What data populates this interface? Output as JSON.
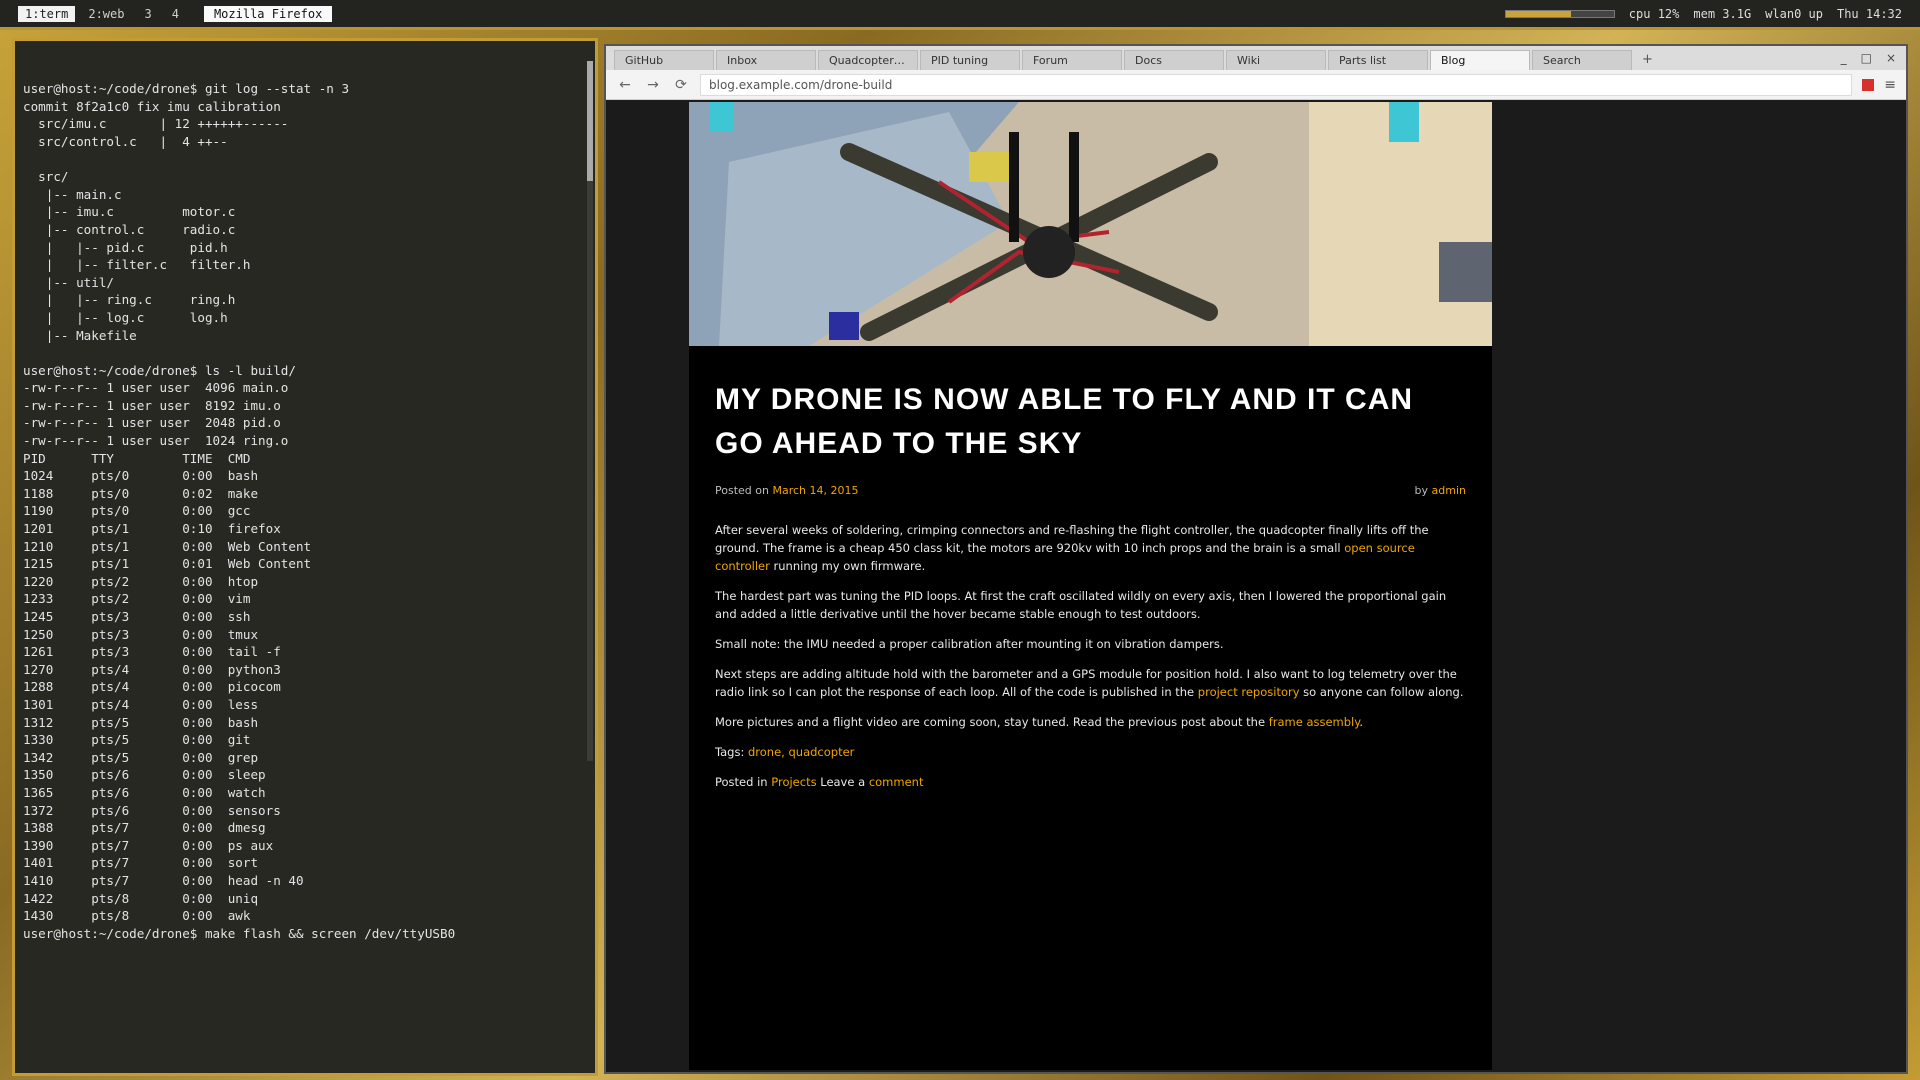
{
  "topbar": {
    "workspaces": [
      {
        "label": "1:term",
        "active": true
      },
      {
        "label": "2:web",
        "active": false
      },
      {
        "label": "3",
        "active": false
      },
      {
        "label": "4",
        "active": false
      }
    ],
    "window_title": "Mozilla Firefox",
    "volume_pct": 60,
    "status": [
      "cpu 12%",
      "mem 3.1G",
      "wlan0 up",
      "Thu 14:32"
    ]
  },
  "terminal": {
    "lines": [
      "user@host:~/code/drone$ git log --stat -n 3",
      "commit 8f2a1c0 fix imu calibration",
      "  src/imu.c       | 12 ++++++------",
      "  src/control.c   |  4 ++--",
      "",
      "  src/",
      "   |-- main.c",
      "   |-- imu.c         motor.c",
      "   |-- control.c     radio.c",
      "   |   |-- pid.c      pid.h",
      "   |   |-- filter.c   filter.h",
      "   |-- util/",
      "   |   |-- ring.c     ring.h",
      "   |   |-- log.c      log.h",
      "   |-- Makefile",
      "",
      "user@host:~/code/drone$ ls -l build/",
      "-rw-r--r-- 1 user user  4096 main.o",
      "-rw-r--r-- 1 user user  8192 imu.o",
      "-rw-r--r-- 1 user user  2048 pid.o",
      "-rw-r--r-- 1 user user  1024 ring.o",
      "PID      TTY         TIME  CMD",
      "1024     pts/0       0:00  bash",
      "1188     pts/0       0:02  make",
      "1190     pts/0       0:00  gcc",
      "1201     pts/1       0:10  firefox",
      "1210     pts/1       0:00  Web Content",
      "1215     pts/1       0:01  Web Content",
      "1220     pts/2       0:00  htop",
      "1233     pts/2       0:00  vim",
      "1245     pts/3       0:00  ssh",
      "1250     pts/3       0:00  tmux",
      "1261     pts/3       0:00  tail -f",
      "1270     pts/4       0:00  python3",
      "1288     pts/4       0:00  picocom",
      "1301     pts/4       0:00  less",
      "1312     pts/5       0:00  bash",
      "1330     pts/5       0:00  git",
      "1342     pts/5       0:00  grep",
      "1350     pts/6       0:00  sleep",
      "1365     pts/6       0:00  watch",
      "1372     pts/6       0:00  sensors",
      "1388     pts/7       0:00  dmesg",
      "1390     pts/7       0:00  ps aux",
      "1401     pts/7       0:00  sort",
      "1410     pts/7       0:00  head -n 40",
      "1422     pts/8       0:00  uniq",
      "1430     pts/8       0:00  awk",
      "user@host:~/code/drone$ make flash && screen /dev/ttyUSB0"
    ]
  },
  "browser": {
    "tabs": [
      {
        "label": "GitHub",
        "active": false
      },
      {
        "label": "Inbox",
        "active": false
      },
      {
        "label": "Quadcopter build",
        "active": false
      },
      {
        "label": "PID tuning",
        "active": false
      },
      {
        "label": "Forum",
        "active": false
      },
      {
        "label": "Docs",
        "active": false
      },
      {
        "label": "Wiki",
        "active": false
      },
      {
        "label": "Parts list",
        "active": false
      },
      {
        "label": "Blog",
        "active": true
      },
      {
        "label": "Search",
        "active": false
      }
    ],
    "new_tab": "+",
    "win_controls": [
      "_",
      "□",
      "×"
    ],
    "back": "←",
    "forward": "→",
    "reload": "⟳",
    "url": "blog.example.com/drone-build",
    "menu": "≡"
  },
  "article": {
    "title": "My drone is now able to fly and it can go ahead to the sky",
    "byline_prefix": "Posted on",
    "date": "March 14, 2015",
    "author_prefix": "by",
    "author": "admin",
    "paragraphs": [
      {
        "text": "After several weeks of soldering, crimping connectors and re-flashing the flight controller, the quadcopter finally lifts off the ground. The frame is a cheap 450 class kit, the motors are 920kv with 10 inch props and the brain is a small ",
        "link": "open source controller",
        "tail": " running my own firmware."
      },
      {
        "text": "The hardest part was tuning the PID loops. At first the craft oscillated wildly on every axis, then I lowered the proportional gain and added a little derivative until the hover became stable enough to test outdoors.",
        "link": "",
        "tail": ""
      },
      {
        "text": "Small note: the IMU needed a proper calibration after mounting it on vibration dampers.",
        "link": "",
        "tail": ""
      },
      {
        "text": "Next steps are adding altitude hold with the barometer and a GPS module for position hold. I also want to log telemetry over the radio link so I can plot the response of each loop. All of the code is published in the ",
        "link": "project repository",
        "tail": " so anyone can follow along."
      },
      {
        "text": "More pictures and a flight video are coming soon, stay tuned. Read the previous post about the ",
        "link": "frame assembly",
        "tail": "."
      }
    ],
    "tags_label": "Tags:",
    "tags": "drone, quadcopter",
    "category_label": "Posted in",
    "category": "Projects",
    "comments_label": "Leave a",
    "comments_link": "comment"
  }
}
